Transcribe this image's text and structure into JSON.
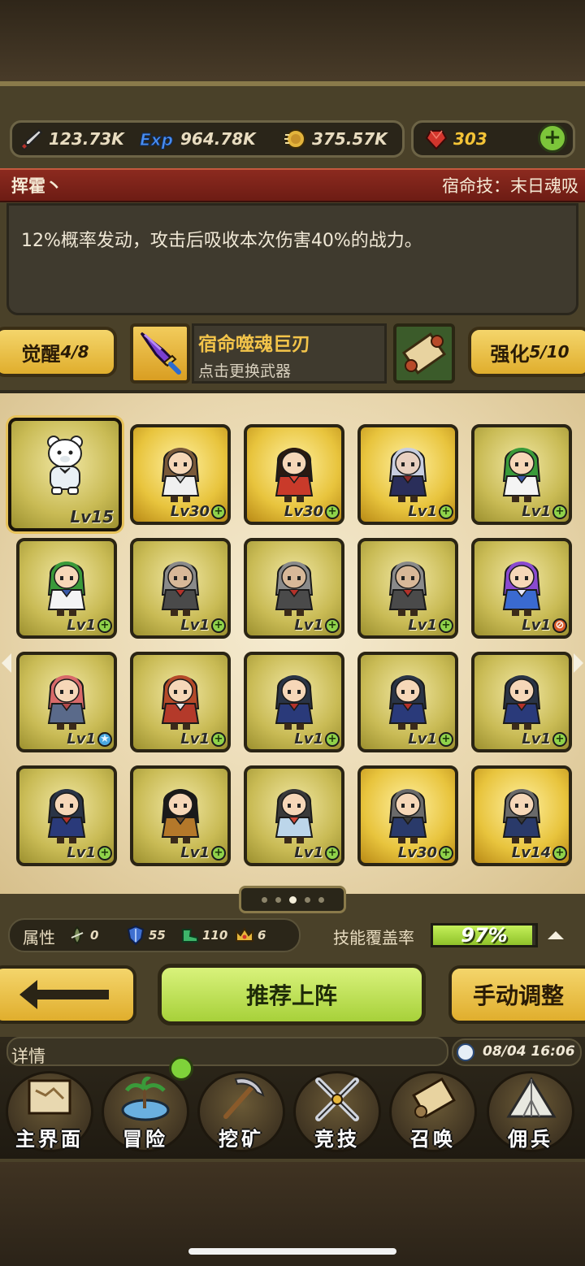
{
  "resources": {
    "attack": "123.73K",
    "exp_label": "Exp",
    "exp": "964.78K",
    "gold": "375.57K",
    "gems": "303"
  },
  "fate": {
    "hero_name": "挥霍丶",
    "skill": "宿命技：末日魂吸",
    "description": "12%概率发动，攻击后吸收本次伤害40%的战力。"
  },
  "equip": {
    "awaken_label": "觉醒",
    "awaken_value": "4/8",
    "weapon_name": "宿命噬魂巨刃",
    "weapon_hint": "点击更换武器",
    "enhance_label": "强化",
    "enhance_value": "5/10"
  },
  "heroes": [
    {
      "level": "Lv15",
      "card": "yellow",
      "badge": "",
      "char": "bear",
      "selected": true
    },
    {
      "level": "Lv30",
      "card": "gold",
      "badge": "plus",
      "char": "brown-girl"
    },
    {
      "level": "Lv30",
      "card": "gold",
      "badge": "plus",
      "char": "red-girl"
    },
    {
      "level": "Lv1",
      "card": "gold",
      "badge": "plus",
      "char": "silver-knight"
    },
    {
      "level": "Lv1",
      "card": "yellow",
      "badge": "plus",
      "char": "green-girl"
    },
    {
      "level": "Lv1",
      "card": "yellow",
      "badge": "plus",
      "char": "green-girl"
    },
    {
      "level": "Lv1",
      "card": "yellow",
      "badge": "plus",
      "char": "armored-rider"
    },
    {
      "level": "Lv1",
      "card": "yellow",
      "badge": "plus",
      "char": "armored-rider"
    },
    {
      "level": "Lv1",
      "card": "yellow",
      "badge": "plus",
      "char": "armored-rider"
    },
    {
      "level": "Lv1",
      "card": "yellow",
      "badge": "no",
      "char": "purple-girl"
    },
    {
      "level": "Lv1",
      "card": "yellow",
      "badge": "star",
      "char": "pink-girl"
    },
    {
      "level": "Lv1",
      "card": "yellow",
      "badge": "plus",
      "char": "red-twin"
    },
    {
      "level": "Lv1",
      "card": "yellow",
      "badge": "plus",
      "char": "dark-caped"
    },
    {
      "level": "Lv1",
      "card": "yellow",
      "badge": "plus",
      "char": "dark-caped"
    },
    {
      "level": "Lv1",
      "card": "yellow",
      "badge": "plus",
      "char": "dark-caped"
    },
    {
      "level": "Lv1",
      "card": "yellow",
      "badge": "plus",
      "char": "dark-caped"
    },
    {
      "level": "Lv1",
      "card": "yellow",
      "badge": "plus",
      "char": "black-hair"
    },
    {
      "level": "Lv1",
      "card": "yellow",
      "badge": "plus",
      "char": "headband-girl"
    },
    {
      "level": "Lv30",
      "card": "gold",
      "badge": "plus",
      "char": "grey-caped"
    },
    {
      "level": "Lv14",
      "card": "gold",
      "badge": "plus",
      "char": "grey-caped"
    }
  ],
  "pager": {
    "count": 5,
    "active": 3
  },
  "attributes": {
    "label": "属性",
    "items": [
      {
        "icon": "wind-icon",
        "value": "0"
      },
      {
        "icon": "shield-icon",
        "value": "55"
      },
      {
        "icon": "boot-icon",
        "value": "110"
      },
      {
        "icon": "crown-icon",
        "value": "6"
      }
    ],
    "coverage_label": "技能覆盖率",
    "coverage_value": "97%",
    "coverage_fraction": 0.97
  },
  "actions": {
    "recommend": "推荐上阵",
    "manual": "手动调整"
  },
  "status": {
    "details": "详情",
    "datetime": "08/04 16:06"
  },
  "nav": [
    {
      "label": "主界面",
      "icon": "map-scroll-icon"
    },
    {
      "label": "冒险",
      "icon": "island-icon"
    },
    {
      "label": "挖矿",
      "icon": "pickaxe-icon"
    },
    {
      "label": "竞技",
      "icon": "crossed-swords-icon"
    },
    {
      "label": "召唤",
      "icon": "summon-scroll-icon"
    },
    {
      "label": "佣兵",
      "icon": "tent-icon"
    }
  ],
  "colors": {
    "accent_gold": "#f4c437",
    "fate_red": "#8c2a1f",
    "coverage_green": "#a7d13a"
  }
}
